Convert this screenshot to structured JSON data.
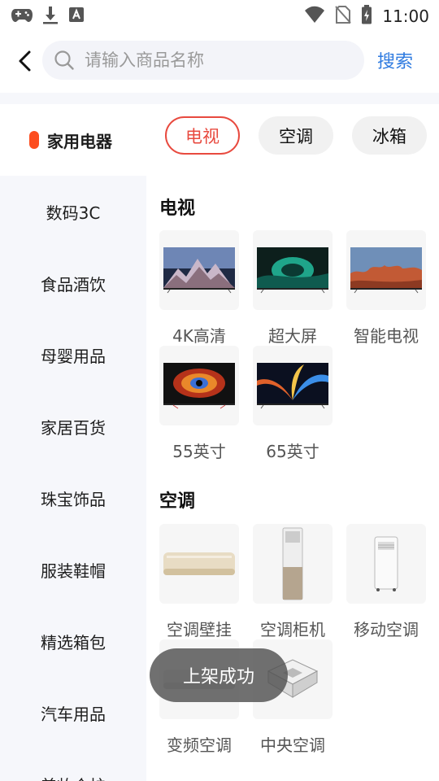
{
  "status_bar": {
    "time": "11:00"
  },
  "header": {
    "search_placeholder": "请输入商品名称",
    "search_button": "搜索"
  },
  "sidebar": {
    "items": [
      {
        "label": "家用电器",
        "active": true
      },
      {
        "label": "数码3C"
      },
      {
        "label": "食品酒饮"
      },
      {
        "label": "母婴用品"
      },
      {
        "label": "家居百货"
      },
      {
        "label": "珠宝饰品"
      },
      {
        "label": "服装鞋帽"
      },
      {
        "label": "精选箱包"
      },
      {
        "label": "汽车用品"
      },
      {
        "label": "美妆个护"
      }
    ]
  },
  "chips": [
    {
      "label": "电视",
      "active": true
    },
    {
      "label": "空调"
    },
    {
      "label": "冰箱"
    }
  ],
  "sections": [
    {
      "title": "电视",
      "items": [
        "4K高清",
        "超大屏",
        "智能电视",
        "55英寸",
        "65英寸"
      ]
    },
    {
      "title": "空调",
      "items": [
        "空调壁挂",
        "空调柜机",
        "移动空调",
        "变频空调",
        "中央空调"
      ]
    }
  ],
  "toast": {
    "text": "上架成功"
  },
  "colors": {
    "accent_orange": "#fd4d1f",
    "accent_red": "#e84a3f",
    "link_blue": "#2f7be0"
  }
}
